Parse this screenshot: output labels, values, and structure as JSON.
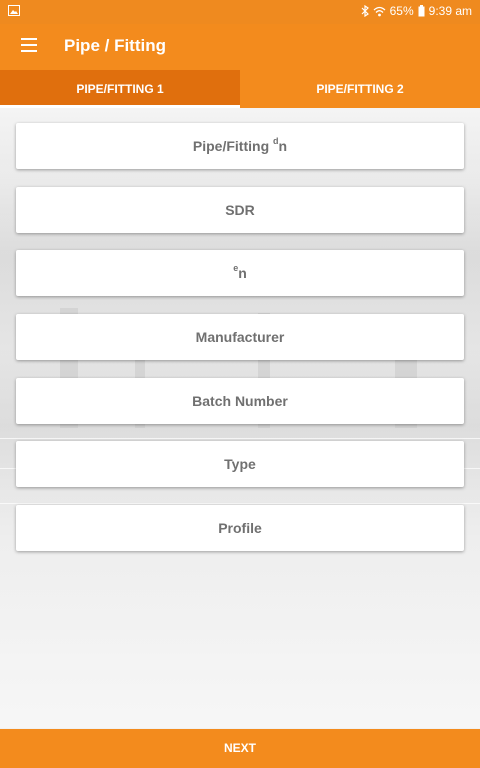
{
  "status_bar": {
    "battery": "65%",
    "time": "9:39 am"
  },
  "app_bar": {
    "title": "Pipe / Fitting"
  },
  "tabs": [
    {
      "label": "PIPE/FITTING 1",
      "active": true
    },
    {
      "label": "PIPE/FITTING 2",
      "active": false
    }
  ],
  "fields": {
    "dn": {
      "main": "Pipe/Fitting ",
      "sup": "d",
      "sub": "n"
    },
    "sdr": "SDR",
    "en": {
      "sup": "e",
      "sub": "n"
    },
    "manufacturer": "Manufacturer",
    "batch_number": "Batch Number",
    "type": "Type",
    "profile": "Profile"
  },
  "footer": {
    "next_label": "NEXT"
  },
  "colors": {
    "primary": "#f38b1d",
    "primary_dark": "#e06f0d",
    "field_text": "#707070"
  },
  "icons": [
    "image-icon",
    "bluetooth-icon",
    "wifi-icon",
    "battery-icon",
    "menu-icon"
  ]
}
